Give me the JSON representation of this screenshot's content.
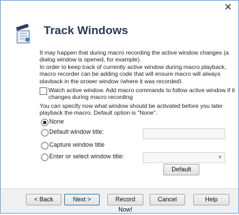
{
  "window": {
    "close_glyph": "✕"
  },
  "header": {
    "title": "Track Windows",
    "icon": "clapperboard-icon"
  },
  "description": "It may happen that during macro recording the active window changes (a\ndialog window is opened, for example).\nIn order to keep track of currently active window during macro playback,\nmacro recorder can be adding code that will ensure macro will always\nplayback in the proper window (where it was recorded).",
  "watch_checkbox": {
    "label": "Watch active window. Add macro commands to follow active window if it changes during macro recording",
    "checked": false
  },
  "specify_text": "You can specify now what window should be activated before you later\nplayback the macro.  Default option is \"None\".",
  "options": {
    "none": {
      "label": "None",
      "selected": true
    },
    "default_title": {
      "label": "Default window title:",
      "selected": false,
      "value": ""
    },
    "capture": {
      "label": "Capture window title",
      "selected": false
    },
    "enter_select": {
      "label": "Enter or select window title:",
      "selected": false,
      "value": ""
    }
  },
  "default_button": "Default",
  "footer": {
    "back": "< Back",
    "next": "Next >",
    "record": "Record Now!",
    "cancel": "Cancel",
    "help": "Help"
  },
  "colors": {
    "title": "#2b3a53",
    "border": "#6fa9d8",
    "footer_bg": "#f0f0f0"
  }
}
